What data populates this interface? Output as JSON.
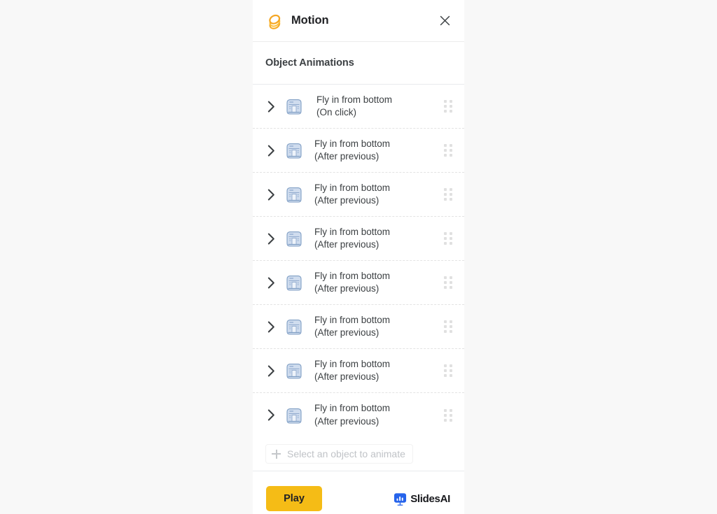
{
  "background_color": "#f8f8f8",
  "panel": {
    "header": {
      "logo_icon": "motion-stacked-circles-logo",
      "logo_color": "#F5A623",
      "title": "Motion",
      "close_icon": "close-icon"
    },
    "section": {
      "heading": "Object Animations"
    },
    "animations": [
      {
        "effect": "Fly in from bottom",
        "trigger": "(On click)",
        "expand_icon": "chevron-right-icon",
        "thumbnail": "slide-object-thumbnail",
        "drag_icon": "drag-handle-icon"
      },
      {
        "effect": "Fly in from bottom",
        "trigger": "(After previous)",
        "expand_icon": "chevron-right-icon",
        "thumbnail": "slide-object-thumbnail",
        "drag_icon": "drag-handle-icon"
      },
      {
        "effect": "Fly in from bottom",
        "trigger": "(After previous)",
        "expand_icon": "chevron-right-icon",
        "thumbnail": "slide-object-thumbnail",
        "drag_icon": "drag-handle-icon"
      },
      {
        "effect": "Fly in from bottom",
        "trigger": "(After previous)",
        "expand_icon": "chevron-right-icon",
        "thumbnail": "slide-object-thumbnail",
        "drag_icon": "drag-handle-icon"
      },
      {
        "effect": "Fly in from bottom",
        "trigger": "(After previous)",
        "expand_icon": "chevron-right-icon",
        "thumbnail": "slide-object-thumbnail",
        "drag_icon": "drag-handle-icon"
      },
      {
        "effect": "Fly in from bottom",
        "trigger": "(After previous)",
        "expand_icon": "chevron-right-icon",
        "thumbnail": "slide-object-thumbnail",
        "drag_icon": "drag-handle-icon"
      },
      {
        "effect": "Fly in from bottom",
        "trigger": "(After previous)",
        "expand_icon": "chevron-right-icon",
        "thumbnail": "slide-object-thumbnail",
        "drag_icon": "drag-handle-icon"
      },
      {
        "effect": "Fly in from bottom",
        "trigger": "(After previous)",
        "expand_icon": "chevron-right-icon",
        "thumbnail": "slide-object-thumbnail",
        "drag_icon": "drag-handle-icon"
      }
    ],
    "add_row": {
      "icon": "plus-icon",
      "label": "Select an object to animate"
    },
    "footer": {
      "play_label": "Play",
      "play_color": "#F5BC16",
      "brand_name": "SlidesAI",
      "brand_icon": "slidesai-presentation-chart-icon",
      "brand_icon_color": "#2563EB"
    }
  }
}
